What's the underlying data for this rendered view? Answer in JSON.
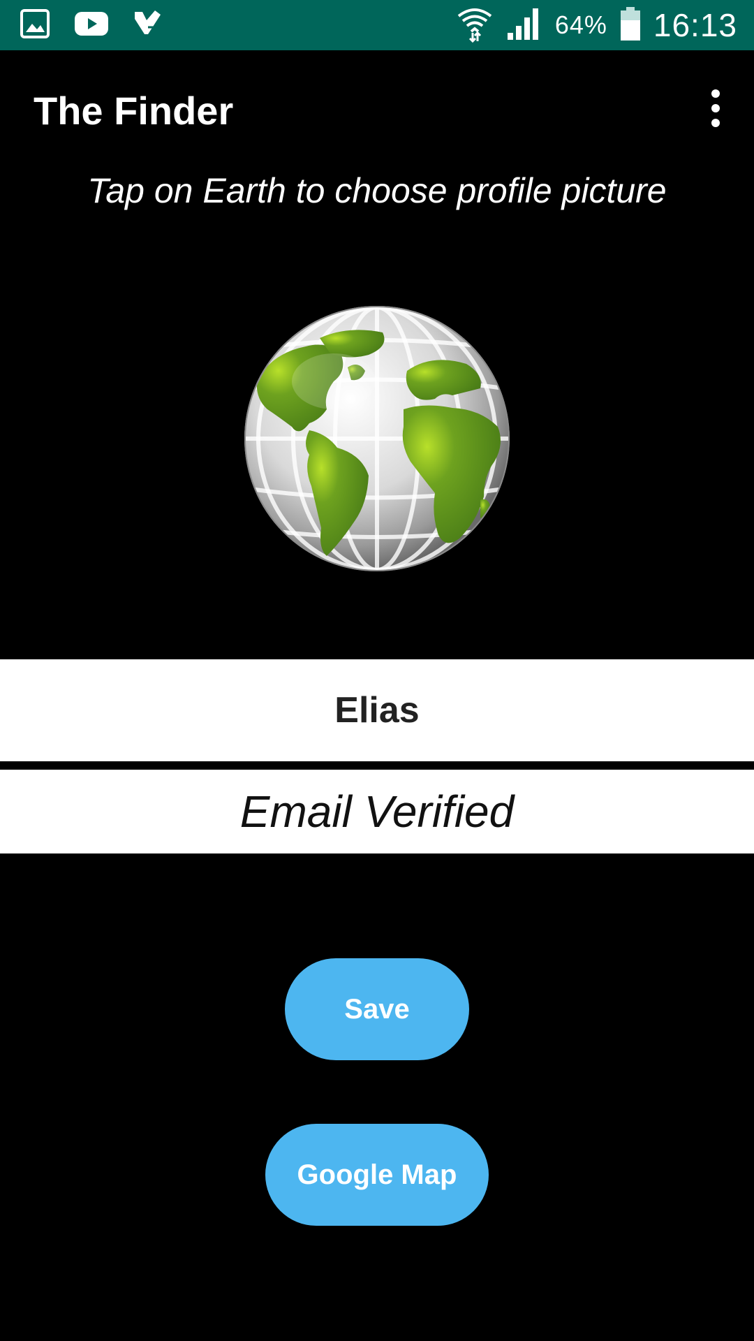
{
  "status_bar": {
    "left_icons": [
      "gallery-icon",
      "youtube-icon",
      "tasks-icon"
    ],
    "right_icons": [
      "wifi-icon",
      "signal-icon",
      "battery-icon"
    ],
    "battery_percent": "64%",
    "time": "16:13",
    "background_color": "#00665a"
  },
  "app_bar": {
    "title": "The Finder",
    "menu_icon": "overflow-menu-icon"
  },
  "profile": {
    "instruction": "Tap on Earth to choose profile picture",
    "picture_icon": "globe-icon",
    "name": "Elias",
    "email_status": "Email Verified"
  },
  "actions": {
    "save_label": "Save",
    "map_label": "Google Map",
    "button_color": "#4db6f0"
  }
}
